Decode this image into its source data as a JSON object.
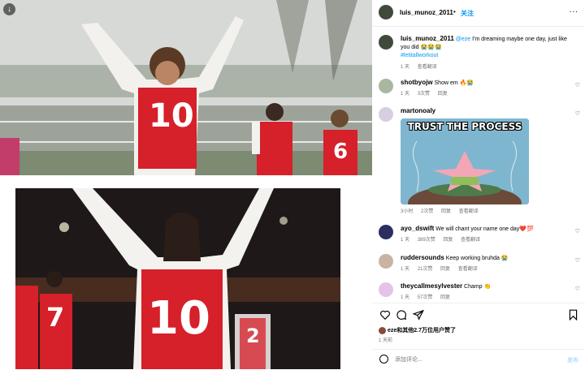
{
  "header": {
    "username": "luis_munoz_2011",
    "separator": "•",
    "follow": "关注",
    "more": "..."
  },
  "caption": {
    "username": "luis_munoz_2011",
    "mention": "@eze",
    "text": " I'm dreaming maybe one day, just like you did 😭😭😭",
    "hashtag": "#letitallworkout",
    "time": "1 天",
    "translate": "查看翻译"
  },
  "comments": [
    {
      "username": "shotbyojw",
      "text": "Show em 🔥😭",
      "time": "1 天",
      "likes": "3次赞",
      "reply": "回复"
    },
    {
      "username": "martonoaly",
      "text": "",
      "time": "3小时",
      "likes": "2次赞",
      "reply": "回复",
      "translate": "查看翻译",
      "meme_text": "TRUST THE PROCESS"
    },
    {
      "username": "ayo_dswift",
      "text": "We will chant your name one day❤️💯",
      "time": "1 天",
      "likes": "389次赞",
      "reply": "回复",
      "translate": "查看翻译"
    },
    {
      "username": "ruddersounds",
      "text": "Keep working bruhda 😭",
      "time": "1 天",
      "likes": "21次赞",
      "reply": "回复",
      "translate": "查看翻译"
    },
    {
      "username": "theycallmesylvester",
      "text": "Champ 👏",
      "time": "1 天",
      "likes": "57次赞",
      "reply": "回复"
    }
  ],
  "likes_line": "eze和其他2.7万位用户赞了",
  "post_date": "1 天前",
  "add_comment": {
    "placeholder": "添加评论...",
    "post": "发布"
  },
  "media": {
    "jersey1": "10",
    "jersey2": "10",
    "jersey3": "6",
    "jersey4": "7",
    "jersey5": "2"
  },
  "colors": {
    "arsenal_red": "#d6202a",
    "link_blue": "#0095f6"
  }
}
